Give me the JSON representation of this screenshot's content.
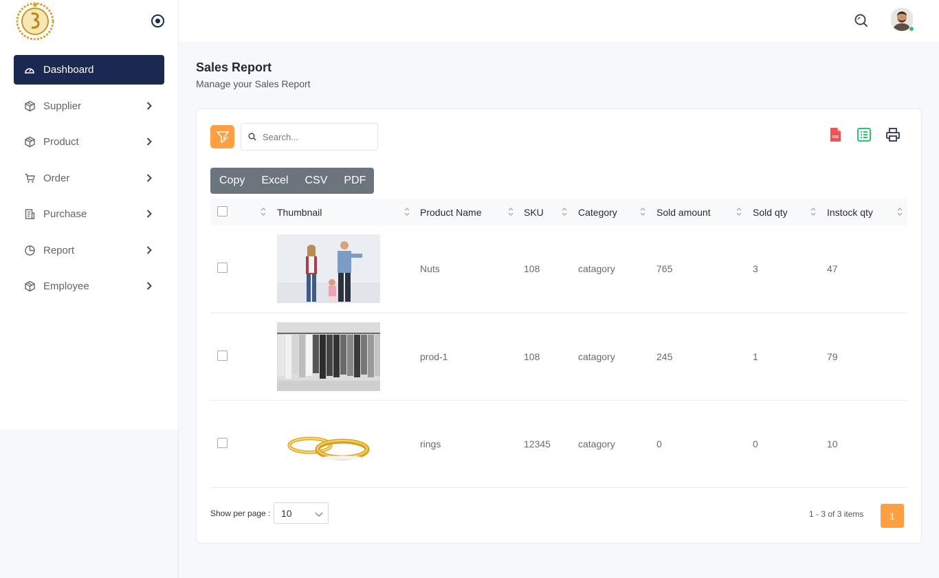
{
  "sidebar": {
    "items": [
      {
        "label": "Dashboard",
        "icon": "dashboard-gauge-icon"
      },
      {
        "label": "Supplier",
        "icon": "box-icon"
      },
      {
        "label": "Product",
        "icon": "box-icon"
      },
      {
        "label": "Order",
        "icon": "cart-icon"
      },
      {
        "label": "Purchase",
        "icon": "receipt-icon"
      },
      {
        "label": "Report",
        "icon": "pie-chart-icon"
      },
      {
        "label": "Employee",
        "icon": "box-icon"
      }
    ]
  },
  "page": {
    "title": "Sales Report",
    "subtitle": "Manage your Sales Report"
  },
  "toolbar": {
    "search_placeholder": "Search...",
    "buttons": [
      "Copy",
      "Excel",
      "CSV",
      "PDF"
    ]
  },
  "table": {
    "headers": [
      "Thumbnail",
      "Product Name",
      "SKU",
      "Category",
      "Sold amount",
      "Sold qty",
      "Instock qty"
    ],
    "rows": [
      {
        "thumbnail": "family-photo",
        "name": "Nuts",
        "sku": "108",
        "category": "catagory",
        "sold_amount": "765",
        "sold_qty": "3",
        "instock_qty": "47"
      },
      {
        "thumbnail": "clothes-rack-photo",
        "name": "prod-1",
        "sku": "108",
        "category": "catagory",
        "sold_amount": "245",
        "sold_qty": "1",
        "instock_qty": "79"
      },
      {
        "thumbnail": "gold-rings-photo",
        "name": "rings",
        "sku": "12345",
        "category": "catagory",
        "sold_amount": "0",
        "sold_qty": "0",
        "instock_qty": "10"
      }
    ]
  },
  "footer": {
    "per_page_label": "Show per page :",
    "per_page_value": "10",
    "range_text": "1 - 3 of 3 items",
    "current_page": "1"
  },
  "colors": {
    "primary_dark": "#1b2850",
    "accent_orange": "#ff9f43",
    "pdf_red": "#ea5455",
    "excel_green": "#28c76f"
  }
}
